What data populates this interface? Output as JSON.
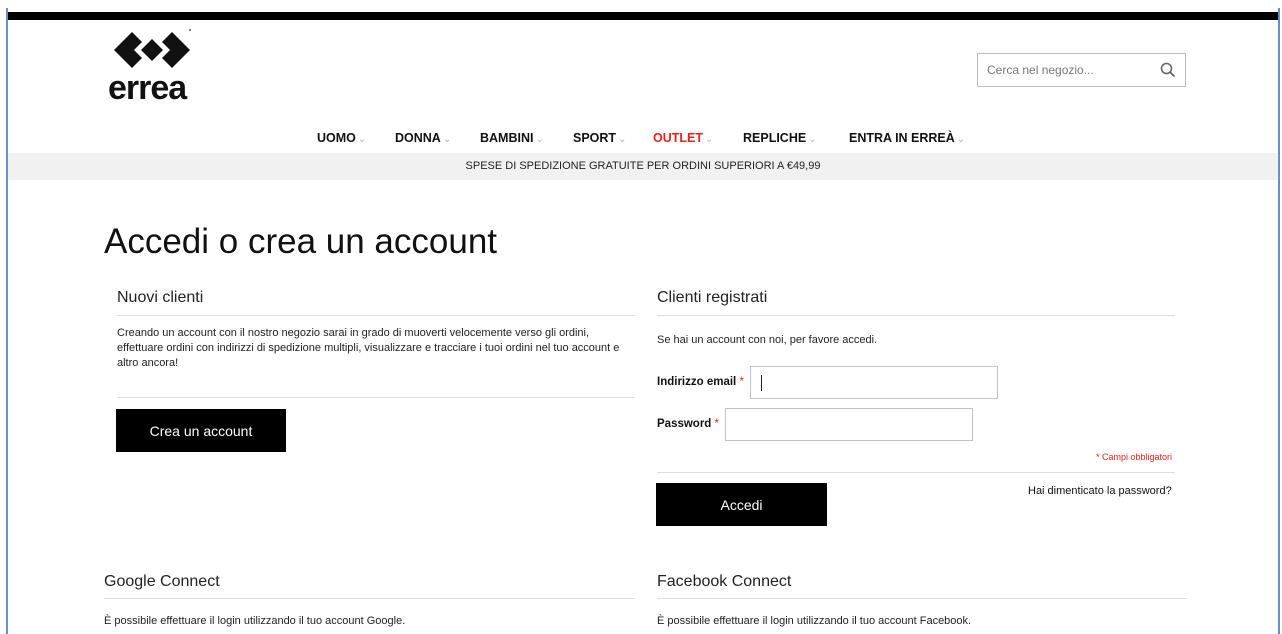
{
  "brand": {
    "logo_text": "errea"
  },
  "search": {
    "placeholder": "Cerca nel negozio..."
  },
  "nav": {
    "items": [
      {
        "label": "UOMO"
      },
      {
        "label": "DONNA"
      },
      {
        "label": "BAMBINI"
      },
      {
        "label": "SPORT"
      },
      {
        "label": "OUTLET"
      },
      {
        "label": "REPLICHE"
      },
      {
        "label": "ENTRA IN ERREÀ"
      }
    ],
    "chevron": "⌄"
  },
  "shipping_banner": "SPESE DI SPEDIZIONE GRATUITE PER ORDINI SUPERIORI A €49,99",
  "page_title": "Accedi o crea un account",
  "new_customers": {
    "title": "Nuovi clienti",
    "description": "Creando un account con il nostro negozio sarai in grado di muoverti velocemente verso gli ordini, effettuare ordini con indirizzi di spedizione multipli, visualizzare e tracciare i tuoi ordini nel tuo account e altro ancora!",
    "create_button": "Crea un account"
  },
  "registered_customers": {
    "title": "Clienti registrati",
    "description": "Se hai un account con noi, per favore accedi.",
    "email_label": "Indirizzo email",
    "password_label": "Password",
    "required_mark": "*",
    "email_value": "",
    "password_value": "",
    "required_note": "* Campi obbligatori",
    "login_button": "Accedi",
    "forgot_link": "Hai dimenticato la password?"
  },
  "google_connect": {
    "title": "Google Connect",
    "description": "È possibile effettuare il login utilizzando il tuo account Google."
  },
  "facebook_connect": {
    "title": "Facebook Connect",
    "description": "È possibile effettuare il login utilizzando il tuo account Facebook."
  },
  "colors": {
    "accent_red": "#e2231a",
    "button_black": "#000000",
    "banner_gray": "#f1f1f1"
  },
  "icons": {
    "search": "search-icon",
    "logo": "errea-diamond-logo"
  }
}
